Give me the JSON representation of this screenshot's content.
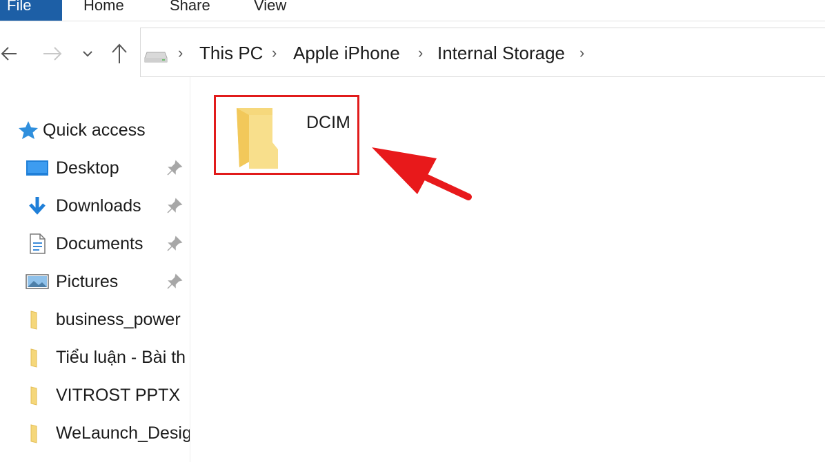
{
  "ribbon": {
    "tabs": [
      "File",
      "Home",
      "Share",
      "View"
    ]
  },
  "nav": {
    "back_icon": "arrow-left-icon",
    "forward_icon": "arrow-right-icon",
    "recent_icon": "chevron-down-icon",
    "up_icon": "arrow-up-icon"
  },
  "breadcrumb": {
    "root_icon": "drive-icon",
    "items": [
      "This PC",
      "Apple iPhone",
      "Internal Storage"
    ]
  },
  "sidebar": {
    "quick_access": "Quick access",
    "items": [
      {
        "label": "Desktop",
        "icon": "desktop-icon",
        "pinned": true
      },
      {
        "label": "Downloads",
        "icon": "download-icon",
        "pinned": true
      },
      {
        "label": "Documents",
        "icon": "document-icon",
        "pinned": true
      },
      {
        "label": "Pictures",
        "icon": "pictures-icon",
        "pinned": true
      },
      {
        "label": "business_power",
        "icon": "folder-icon",
        "pinned": false
      },
      {
        "label": "Tiểu luận - Bài th",
        "icon": "folder-icon",
        "pinned": false
      },
      {
        "label": "VITROST PPTX",
        "icon": "folder-icon",
        "pinned": false
      },
      {
        "label": "WeLaunch_Desig",
        "icon": "folder-icon",
        "pinned": false
      }
    ]
  },
  "content": {
    "folders": [
      {
        "name": "DCIM",
        "icon": "folder-icon",
        "highlighted": true
      }
    ]
  },
  "colors": {
    "file_tab": "#1d5fa6",
    "highlight": "#e11b1b",
    "folder": "#f5d77a"
  }
}
